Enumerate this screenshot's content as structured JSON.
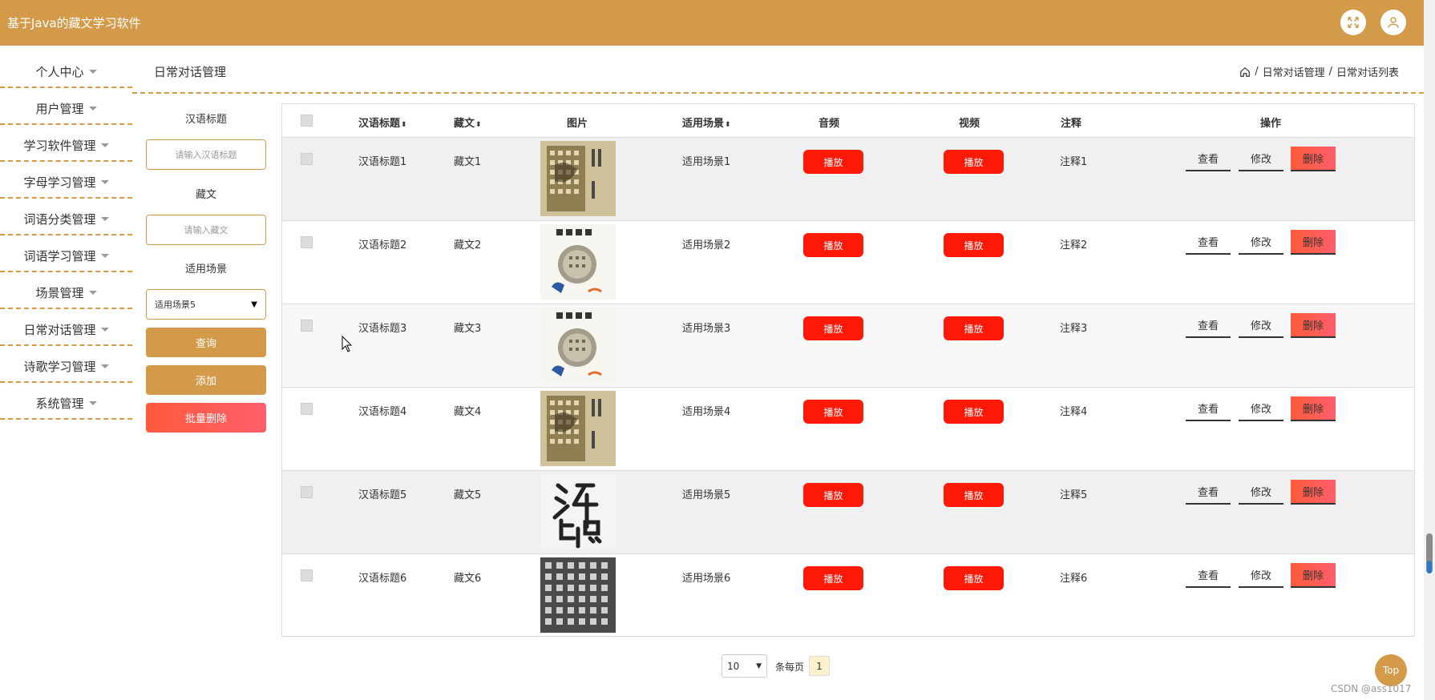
{
  "app": {
    "title": "基于Java的藏文学习软件"
  },
  "header": {
    "expand_icon": "fullscreen-icon",
    "user_icon": "user-icon"
  },
  "sidebar": {
    "items": [
      {
        "label": "个人中心"
      },
      {
        "label": "用户管理"
      },
      {
        "label": "学习软件管理"
      },
      {
        "label": "字母学习管理"
      },
      {
        "label": "词语分类管理"
      },
      {
        "label": "词语学习管理"
      },
      {
        "label": "场景管理"
      },
      {
        "label": "日常对话管理"
      },
      {
        "label": "诗歌学习管理"
      },
      {
        "label": "系统管理"
      }
    ]
  },
  "page": {
    "title": "日常对话管理",
    "breadcrumb": {
      "home_icon": "home-icon",
      "sep": "/",
      "level1": "日常对话管理",
      "level2": "日常对话列表"
    }
  },
  "search": {
    "hanyu_label": "汉语标题",
    "hanyu_placeholder": "请输入汉语标题",
    "zangwen_label": "藏文",
    "zangwen_placeholder": "请输入藏文",
    "scene_label": "适用场景",
    "scene_value": "适用场景5",
    "query_button": "查询",
    "add_button": "添加",
    "batch_delete_button": "批量删除"
  },
  "table": {
    "headers": {
      "title": "汉语标题",
      "zangwen": "藏文",
      "image": "图片",
      "scene": "适用场景",
      "audio": "音频",
      "video": "视频",
      "note": "注释",
      "actions": "操作"
    },
    "sort_glyph": "⬍",
    "play_label": "播放",
    "view_label": "查看",
    "edit_label": "修改",
    "delete_label": "删除",
    "rows": [
      {
        "title": "汉语标题1",
        "zangwen": "藏文1",
        "scene": "适用场景1",
        "note": "注释1",
        "image": "book-cover-gold"
      },
      {
        "title": "汉语标题2",
        "zangwen": "藏文2",
        "scene": "适用场景2",
        "note": "注释2",
        "image": "book-cover-white"
      },
      {
        "title": "汉语标题3",
        "zangwen": "藏文3",
        "scene": "适用场景3",
        "note": "注释3",
        "image": "book-cover-white"
      },
      {
        "title": "汉语标题4",
        "zangwen": "藏文4",
        "scene": "适用场景4",
        "note": "注释4",
        "image": "book-cover-gold"
      },
      {
        "title": "汉语标题5",
        "zangwen": "藏文5",
        "scene": "适用场景5",
        "note": "注释5",
        "image": "calligraphy"
      },
      {
        "title": "汉语标题6",
        "zangwen": "藏文6",
        "scene": "适用场景6",
        "note": "注释6",
        "image": "stone-rubbing"
      }
    ]
  },
  "pagination": {
    "page_size": "10",
    "per_page_label": "条每页",
    "current_page": "1"
  },
  "top_button": "Top",
  "watermark": "CSDN @ass1017",
  "colors": {
    "accent": "#d39b49",
    "play": "#ff1a08",
    "danger": "#ff5a3c"
  }
}
